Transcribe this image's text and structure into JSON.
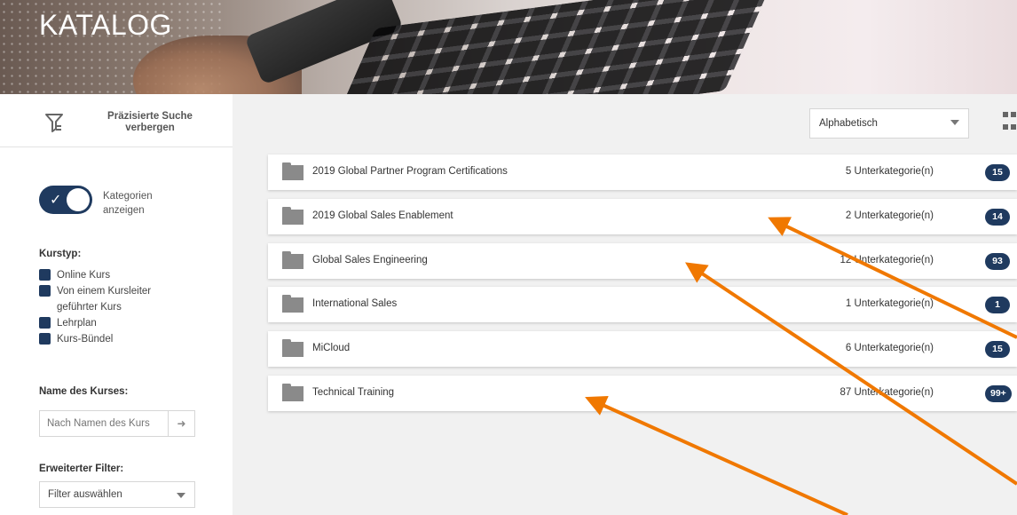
{
  "header": {
    "title": "KATALOG"
  },
  "sidebar": {
    "search_toggle_label": "Präzisierte Suche verbergen",
    "show_categories": {
      "label": "Kategorien anzeigen",
      "checked": true
    },
    "course_type": {
      "title": "Kurstyp:",
      "options": [
        "Online Kurs",
        "Von einem Kursleiter geführter Kurs",
        "Lehrplan",
        "Kurs-Bündel"
      ]
    },
    "course_name": {
      "title": "Name des Kurses:",
      "placeholder": "Nach Namen des Kurs"
    },
    "advanced_filter": {
      "title": "Erweiterter Filter:",
      "value": "Filter auswählen"
    }
  },
  "main": {
    "sort": {
      "value": "Alphabetisch"
    },
    "categories": [
      {
        "name": "2019 Global Partner Program Certifications",
        "subcategories": "5 Unterkategorie(n)",
        "count": "15"
      },
      {
        "name": "2019 Global Sales Enablement",
        "subcategories": "2 Unterkategorie(n)",
        "count": "14"
      },
      {
        "name": "Global Sales Engineering",
        "subcategories": "12 Unterkategorie(n)",
        "count": "93"
      },
      {
        "name": "International Sales",
        "subcategories": "1 Unterkategorie(n)",
        "count": "1"
      },
      {
        "name": "MiCloud",
        "subcategories": "6 Unterkategorie(n)",
        "count": "15"
      },
      {
        "name": "Technical Training",
        "subcategories": "87 Unterkategorie(n)",
        "count": "99+"
      }
    ]
  },
  "colors": {
    "accent": "#1f3a5f",
    "annotation_arrow": "#f07800"
  }
}
